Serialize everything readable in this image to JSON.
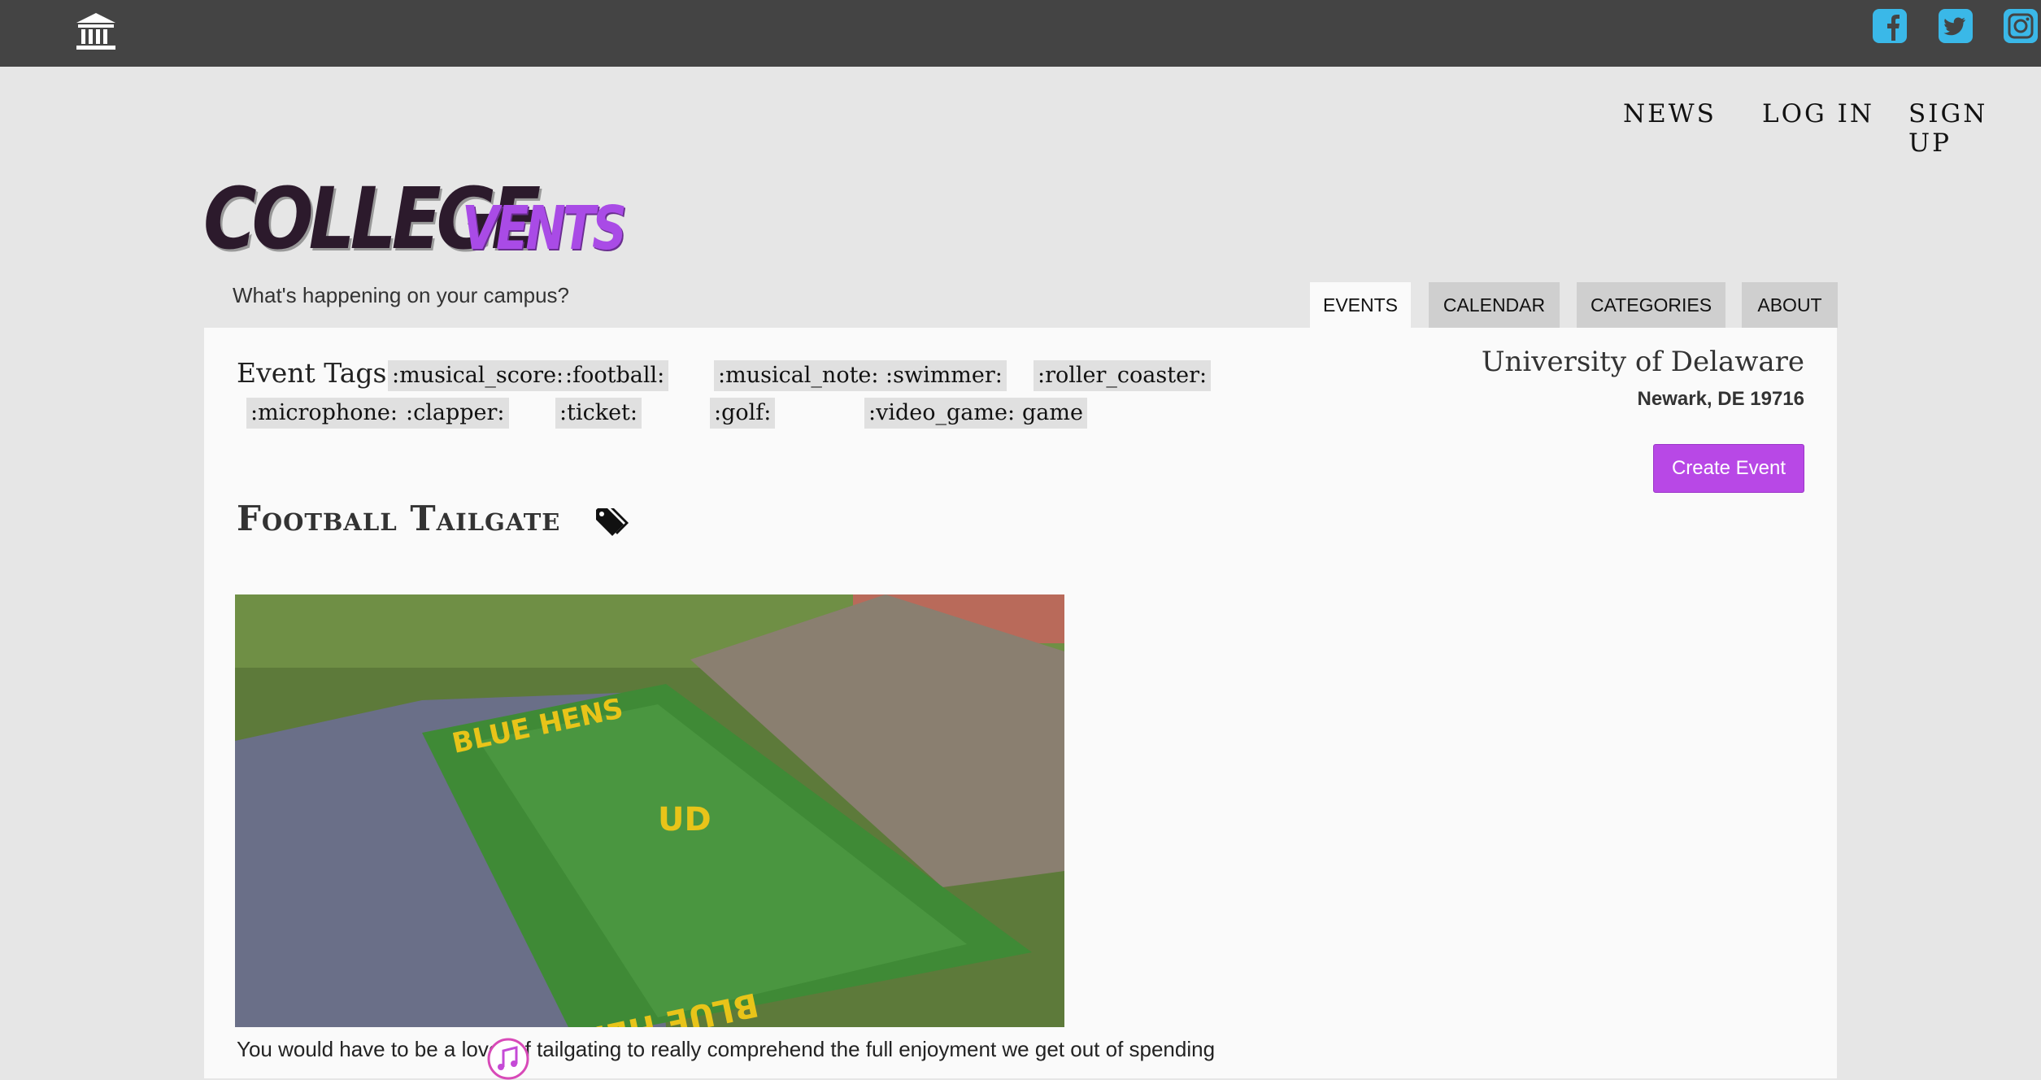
{
  "nav": {
    "news": "NEWS",
    "login": "LOG IN",
    "signup": "SIGN UP"
  },
  "brand": {
    "logo_part1": "COLLEGE",
    "logo_part2": "VENTS",
    "tagline": "What's happening on your campus?",
    "accent_color": "#a94be6",
    "social_color": "#3ab8e8"
  },
  "tabs": [
    "EVENTS",
    "CALENDAR",
    "CATEGORIES",
    "ABOUT"
  ],
  "event_tags": {
    "label": "Event Tags:",
    "row1": [
      ":musical_score:",
      ":football:",
      ":musical_note:",
      ":swimmer:",
      ":roller_coaster:"
    ],
    "row2": [
      ":microphone:",
      ":clapper:",
      ":ticket:",
      ":golf:",
      ":video_game:",
      "game"
    ]
  },
  "location": {
    "university": "University of Delaware",
    "address": "Newark, DE 19716"
  },
  "actions": {
    "create_event": "Create Event"
  },
  "event": {
    "title": "Football Tailgate",
    "image_text_1": "BLUE HENS",
    "image_text_2": "BLUE HENS",
    "description": "You would have to be a lover of tailgating to really comprehend the full enjoyment we get out of spending"
  }
}
